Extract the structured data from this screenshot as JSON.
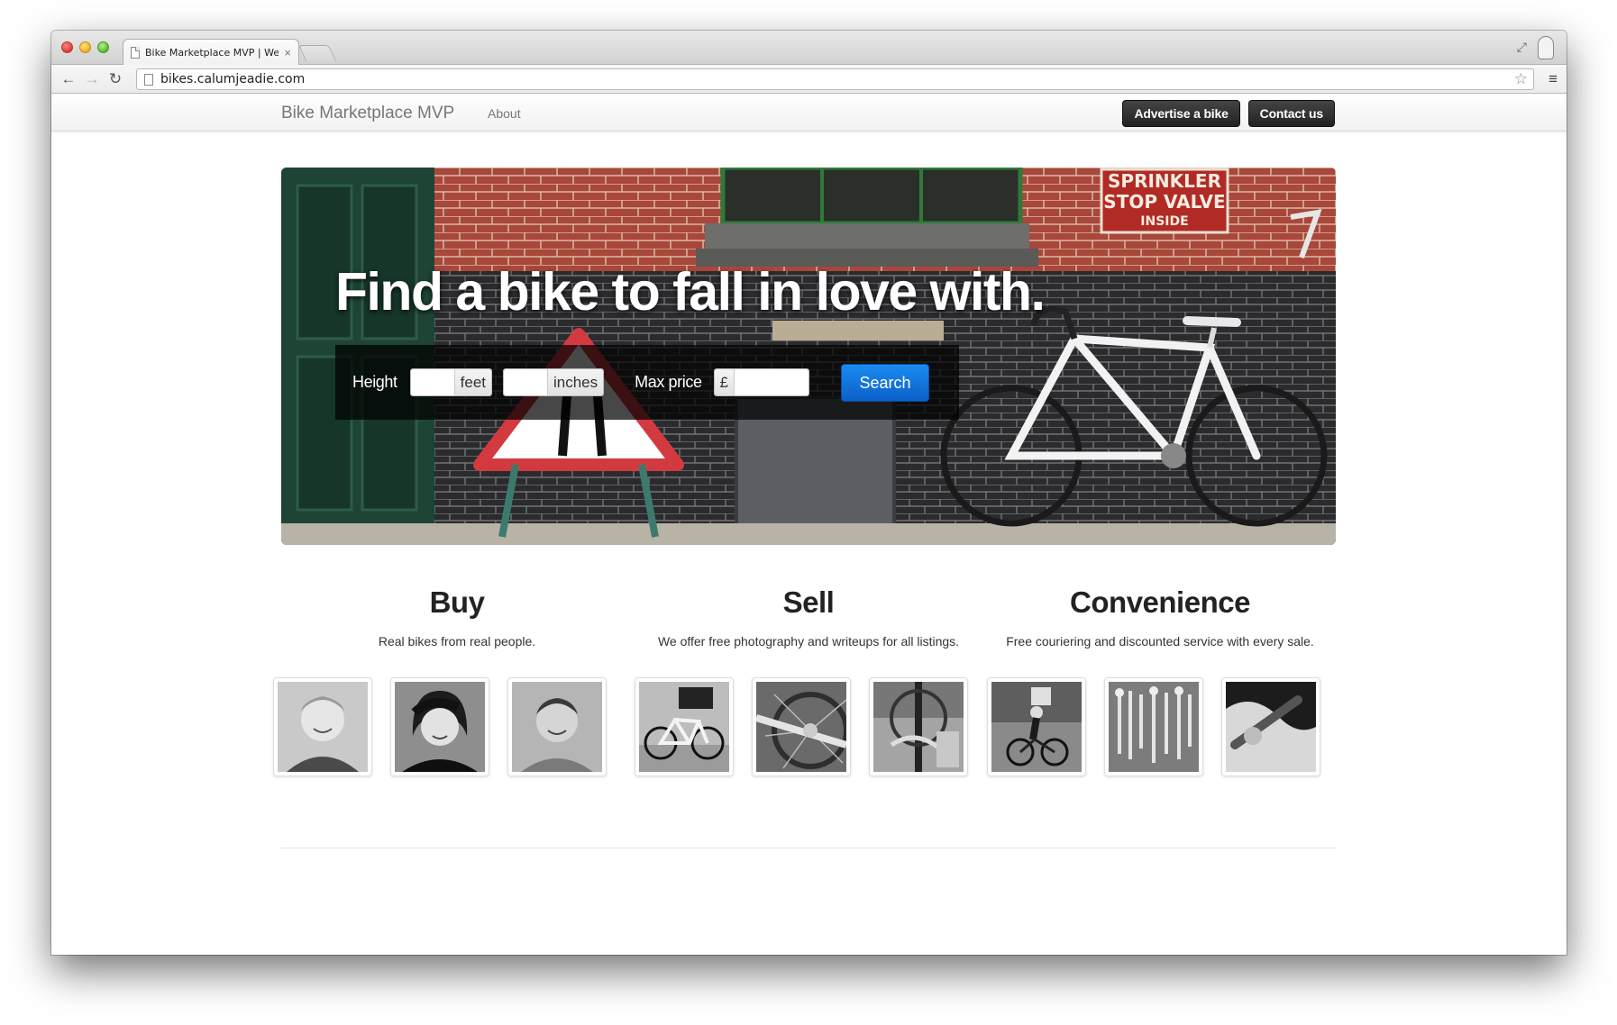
{
  "browser": {
    "tab_title": "Bike Marketplace MVP | We",
    "tab_close": "×",
    "url": "bikes.calumjeadie.com",
    "back": "←",
    "forward": "→",
    "reload": "↻",
    "star": "☆",
    "menu": "≡",
    "fullscreen": "⤢"
  },
  "navbar": {
    "brand": "Bike Marketplace MVP",
    "about": "About",
    "advertise": "Advertise a bike",
    "contact": "Contact us"
  },
  "hero": {
    "title": "Find a bike to fall in love with.",
    "sign_text": [
      "SPRINKLER",
      "STOP VALVE",
      "INSIDE"
    ],
    "height_label": "Height",
    "feet_addon": "feet",
    "inches_addon": "inches",
    "price_label": "Max price",
    "currency_addon": "£",
    "search_button": "Search",
    "feet_value": "",
    "inches_value": "",
    "price_value": ""
  },
  "features": [
    {
      "title": "Buy",
      "description": "Real bikes from real people.",
      "thumbs": [
        "person-photo",
        "person-photo",
        "person-photo"
      ]
    },
    {
      "title": "Sell",
      "description": "We offer free photography and writeups for all listings.",
      "thumbs": [
        "bike-photo",
        "bike-detail-photo",
        "bike-detail-photo"
      ]
    },
    {
      "title": "Convenience",
      "description": "Free couriering and discounted service with every sale.",
      "thumbs": [
        "courier-photo",
        "tools-photo",
        "hand-tool-photo"
      ]
    }
  ],
  "colors": {
    "accent_blue": "#0b6fd6",
    "dark_button": "#2a2a2a",
    "nav_text": "#777777"
  }
}
